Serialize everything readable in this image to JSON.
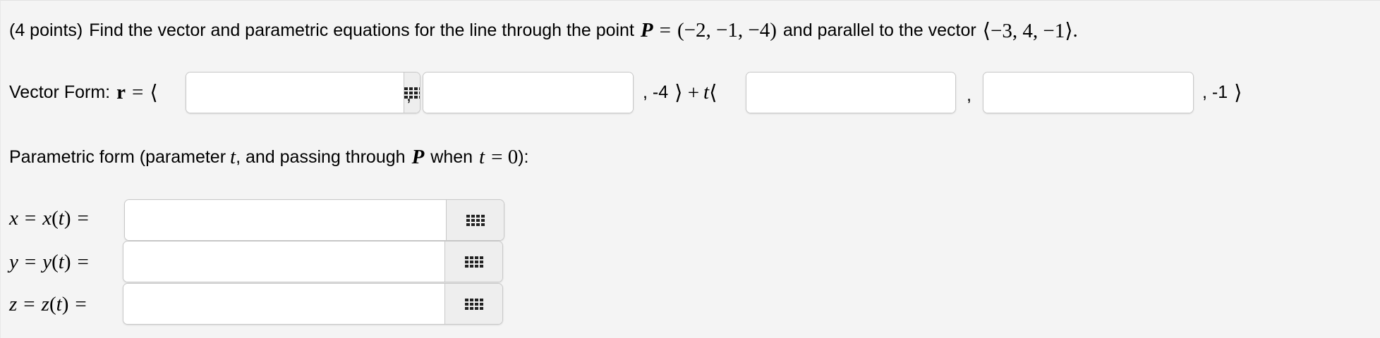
{
  "question": {
    "points": "(4 points)",
    "prompt_a": "Find the vector and parametric equations for the line through the point",
    "point_var": "P",
    "eq": "=",
    "point_value": "(−2, −1, −4)",
    "prompt_b": "and parallel to the vector",
    "vector_value": "⟨−3, 4, −1⟩",
    "end_period": "."
  },
  "vector_form": {
    "label": "Vector Form:",
    "r": "r",
    "eq": "=",
    "open_angle": "⟨",
    "comma": ",",
    "after_second": ", -4",
    "close_plus": "⟩ +",
    "t": "t",
    "open_angle2": "⟨",
    "comma2": ",",
    "after_fourth": ", -1",
    "close_angle": "⟩",
    "fields": [
      {
        "value": ""
      },
      {
        "value": ""
      },
      {
        "value": ""
      },
      {
        "value": ""
      }
    ]
  },
  "parametric": {
    "heading_a": "Parametric form (parameter",
    "t1": "t",
    "heading_b": ", and passing through",
    "P": "P",
    "heading_c": "when",
    "t2": "t",
    "eq_zero": "= 0",
    "heading_end": "):",
    "rows": [
      {
        "var": "x",
        "func": "x",
        "t": "t",
        "value": ""
      },
      {
        "var": "y",
        "func": "y",
        "t": "t",
        "value": ""
      },
      {
        "var": "z",
        "func": "z",
        "t": "t",
        "value": ""
      }
    ]
  },
  "icons": {
    "keyboard": "math-keyboard-icon"
  }
}
